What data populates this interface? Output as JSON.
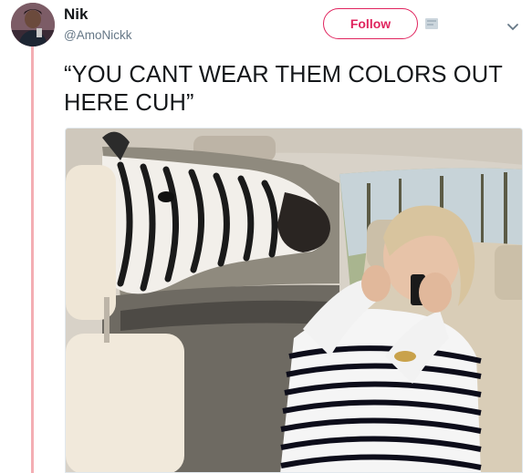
{
  "tweet": {
    "author_name": "Nik",
    "author_handle": "@AmoNickk",
    "follow_label": "Follow",
    "text": "“YOU CANT WEAR THEM COLORS OUT HERE CUH”"
  },
  "icons": {
    "block": "block-icon",
    "more": "chevron-down-icon"
  },
  "colors": {
    "follow_accent": "#e0245e",
    "thread_line": "#f4aeb3",
    "handle_gray": "#657786"
  }
}
